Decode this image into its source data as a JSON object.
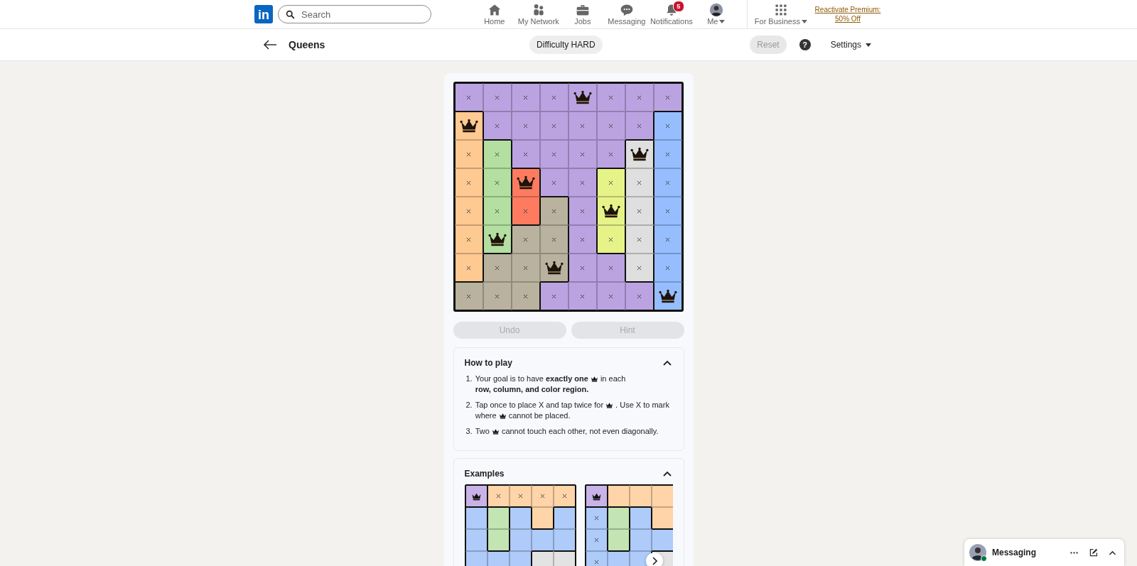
{
  "nav": {
    "logo": "in",
    "search": {
      "placeholder": "Search"
    },
    "items": [
      {
        "label": "Home",
        "dropdown": false
      },
      {
        "label": "My Network",
        "dropdown": false
      },
      {
        "label": "Jobs",
        "dropdown": false
      },
      {
        "label": "Messaging",
        "dropdown": false
      },
      {
        "label": "Notifications",
        "badge": "5",
        "dropdown": false
      },
      {
        "label": "Me",
        "dropdown": true
      }
    ],
    "business": {
      "label": "For Business",
      "dropdown": true
    },
    "premium": "Reactivate Premium: 50% Off"
  },
  "header": {
    "title": "Queens",
    "difficulty": "Difficulty HARD",
    "reset": {
      "label": "Reset",
      "disabled": true
    },
    "help": "?",
    "settings": "Settings"
  },
  "board": {
    "rows": [
      {
        "cells": [
          {
            "color": "#bba3e2",
            "kind": "cross"
          },
          {
            "color": "#bba3e2",
            "kind": "cross"
          },
          {
            "color": "#bba3e2",
            "kind": "cross"
          },
          {
            "color": "#bba3e2",
            "kind": "cross"
          },
          {
            "color": "#bba3e2",
            "kind": "queen"
          },
          {
            "color": "#bba3e2",
            "kind": "cross"
          },
          {
            "color": "#bba3e2",
            "kind": "cross"
          },
          {
            "color": "#bba3e2",
            "kind": "cross"
          }
        ]
      },
      {
        "cells": [
          {
            "color": "#ffc992",
            "kind": "queen"
          },
          {
            "color": "#bba3e2",
            "kind": "cross"
          },
          {
            "color": "#bba3e2",
            "kind": "cross"
          },
          {
            "color": "#bba3e2",
            "kind": "cross"
          },
          {
            "color": "#bba3e2",
            "kind": "cross"
          },
          {
            "color": "#bba3e2",
            "kind": "cross"
          },
          {
            "color": "#bba3e2",
            "kind": "cross"
          },
          {
            "color": "#96beff",
            "kind": "cross"
          }
        ]
      },
      {
        "cells": [
          {
            "color": "#ffc992",
            "kind": "cross"
          },
          {
            "color": "#b3dfa0",
            "kind": "cross"
          },
          {
            "color": "#bba3e2",
            "kind": "cross"
          },
          {
            "color": "#bba3e2",
            "kind": "cross"
          },
          {
            "color": "#bba3e2",
            "kind": "cross"
          },
          {
            "color": "#bba3e2",
            "kind": "cross"
          },
          {
            "color": "#dfdfdf",
            "kind": "queen"
          },
          {
            "color": "#96beff",
            "kind": "cross"
          }
        ]
      },
      {
        "cells": [
          {
            "color": "#ffc992",
            "kind": "cross"
          },
          {
            "color": "#b3dfa0",
            "kind": "cross"
          },
          {
            "color": "#ff7b60",
            "kind": "queen"
          },
          {
            "color": "#bba3e2",
            "kind": "cross"
          },
          {
            "color": "#bba3e2",
            "kind": "cross"
          },
          {
            "color": "#e6f388",
            "kind": "cross"
          },
          {
            "color": "#dfdfdf",
            "kind": "cross"
          },
          {
            "color": "#96beff",
            "kind": "cross"
          }
        ]
      },
      {
        "cells": [
          {
            "color": "#ffc992",
            "kind": "cross"
          },
          {
            "color": "#b3dfa0",
            "kind": "cross"
          },
          {
            "color": "#ff7b60",
            "kind": "cross"
          },
          {
            "color": "#b9b29e",
            "kind": "cross"
          },
          {
            "color": "#bba3e2",
            "kind": "cross"
          },
          {
            "color": "#e6f388",
            "kind": "queen"
          },
          {
            "color": "#dfdfdf",
            "kind": "cross"
          },
          {
            "color": "#96beff",
            "kind": "cross"
          }
        ]
      },
      {
        "cells": [
          {
            "color": "#ffc992",
            "kind": "cross"
          },
          {
            "color": "#b3dfa0",
            "kind": "queen"
          },
          {
            "color": "#b9b29e",
            "kind": "cross"
          },
          {
            "color": "#b9b29e",
            "kind": "cross"
          },
          {
            "color": "#bba3e2",
            "kind": "cross"
          },
          {
            "color": "#e6f388",
            "kind": "cross"
          },
          {
            "color": "#dfdfdf",
            "kind": "cross"
          },
          {
            "color": "#96beff",
            "kind": "cross"
          }
        ]
      },
      {
        "cells": [
          {
            "color": "#ffc992",
            "kind": "cross"
          },
          {
            "color": "#b9b29e",
            "kind": "cross"
          },
          {
            "color": "#b9b29e",
            "kind": "cross"
          },
          {
            "color": "#b9b29e",
            "kind": "queen"
          },
          {
            "color": "#bba3e2",
            "kind": "cross"
          },
          {
            "color": "#bba3e2",
            "kind": "cross"
          },
          {
            "color": "#dfdfdf",
            "kind": "cross"
          },
          {
            "color": "#96beff",
            "kind": "cross"
          }
        ]
      },
      {
        "cells": [
          {
            "color": "#b9b29e",
            "kind": "cross"
          },
          {
            "color": "#b9b29e",
            "kind": "cross"
          },
          {
            "color": "#b9b29e",
            "kind": "cross"
          },
          {
            "color": "#bba3e2",
            "kind": "cross"
          },
          {
            "color": "#bba3e2",
            "kind": "cross"
          },
          {
            "color": "#bba3e2",
            "kind": "cross"
          },
          {
            "color": "#bba3e2",
            "kind": "cross"
          },
          {
            "color": "#96beff",
            "kind": "queen"
          }
        ]
      }
    ]
  },
  "controls": [
    {
      "label": "Undo",
      "disabled": true
    },
    {
      "label": "Hint",
      "disabled": true
    }
  ],
  "how_to_play": {
    "title": "How to play",
    "expanded": true,
    "steps": [
      {
        "number": "1.",
        "parts": [
          {
            "kind": "text",
            "text": "Your goal is to have **exactly one**"
          },
          {
            "kind": "crown"
          },
          {
            "kind": "text",
            "text": "in each"
          },
          {
            "kind": "text",
            "text": "**row, column,**"
          },
          {
            "kind": "text",
            "text": "**and color region.**"
          }
        ]
      },
      {
        "number": "2.",
        "parts": [
          {
            "kind": "text",
            "text": "Tap once to place X and tap twice for"
          },
          {
            "kind": "crown"
          },
          {
            "kind": "text",
            "text": ". Use X to mark"
          },
          {
            "kind": "text",
            "text": "where"
          },
          {
            "kind": "crown"
          },
          {
            "kind": "text",
            "text": "cannot be placed."
          }
        ]
      },
      {
        "number": "3.",
        "parts": [
          {
            "kind": "text",
            "text": "Two"
          },
          {
            "kind": "crown"
          },
          {
            "kind": "text",
            "text": "cannot touch each other, not even diagonally."
          }
        ]
      }
    ]
  },
  "examples": {
    "title": "Examples",
    "expanded": true,
    "boards": [
      {
        "rows": [
          {
            "cells": [
              {
                "color": "#c9b2e8",
                "kind": "queen"
              },
              {
                "color": "#ffd4a8",
                "kind": "cross"
              },
              {
                "color": "#ffd4a8",
                "kind": "cross"
              },
              {
                "color": "#ffd4a8",
                "kind": "cross"
              },
              {
                "color": "#ffd4a8",
                "kind": "cross"
              }
            ]
          },
          {
            "cells": [
              {
                "color": "#aecbfa",
                "kind": "empty"
              },
              {
                "color": "#c3e4b3",
                "kind": "empty"
              },
              {
                "color": "#aecbfa",
                "kind": "empty"
              },
              {
                "color": "#ffd4a8",
                "kind": "empty"
              },
              {
                "color": "#aecbfa",
                "kind": "empty"
              }
            ]
          },
          {
            "cells": [
              {
                "color": "#aecbfa",
                "kind": "empty"
              },
              {
                "color": "#c3e4b3",
                "kind": "empty"
              },
              {
                "color": "#aecbfa",
                "kind": "empty"
              },
              {
                "color": "#aecbfa",
                "kind": "empty"
              },
              {
                "color": "#aecbfa",
                "kind": "empty"
              }
            ]
          },
          {
            "cells": [
              {
                "color": "#aecbfa",
                "kind": "empty"
              },
              {
                "color": "#aecbfa",
                "kind": "empty"
              },
              {
                "color": "#aecbfa",
                "kind": "empty"
              },
              {
                "color": "#e3e3e3",
                "kind": "empty"
              },
              {
                "color": "#e3e3e3",
                "kind": "empty"
              }
            ]
          }
        ]
      },
      {
        "rows": [
          {
            "cells": [
              {
                "color": "#c9b2e8",
                "kind": "queen"
              },
              {
                "color": "#ffd4a8",
                "kind": "empty"
              },
              {
                "color": "#ffd4a8",
                "kind": "empty"
              },
              {
                "color": "#ffd4a8",
                "kind": "empty"
              }
            ]
          },
          {
            "cells": [
              {
                "color": "#aecbfa",
                "kind": "cross"
              },
              {
                "color": "#c3e4b3",
                "kind": "empty"
              },
              {
                "color": "#aecbfa",
                "kind": "empty"
              },
              {
                "color": "#ffd4a8",
                "kind": "empty"
              }
            ]
          },
          {
            "cells": [
              {
                "color": "#aecbfa",
                "kind": "cross"
              },
              {
                "color": "#c3e4b3",
                "kind": "empty"
              },
              {
                "color": "#aecbfa",
                "kind": "empty"
              },
              {
                "color": "#aecbfa",
                "kind": "empty"
              }
            ]
          },
          {
            "cells": [
              {
                "color": "#aecbfa",
                "kind": "cross"
              },
              {
                "color": "#aecbfa",
                "kind": "empty"
              },
              {
                "color": "#aecbfa",
                "kind": "empty"
              },
              {
                "color": "#e3e3e3",
                "kind": "empty"
              }
            ]
          }
        ]
      }
    ]
  },
  "messaging": {
    "title": "Messaging",
    "online": true
  }
}
